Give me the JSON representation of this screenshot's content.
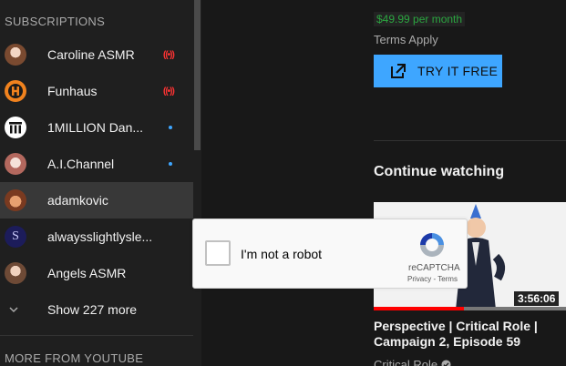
{
  "sidebar": {
    "section_title": "SUBSCRIPTIONS",
    "items": [
      {
        "label": "Caroline ASMR",
        "indicator": "live",
        "avatar_color": "#c9a38a"
      },
      {
        "label": "Funhaus",
        "indicator": "live",
        "avatar_color": "#f0821e"
      },
      {
        "label": "1MILLION Dan...",
        "indicator": "dot",
        "avatar_color": "#ffffff"
      },
      {
        "label": "A.I.Channel",
        "indicator": "dot",
        "avatar_color": "#e8cfc8"
      },
      {
        "label": "adamkovic",
        "indicator": "none",
        "avatar_color": "#d86a3a"
      },
      {
        "label": "alwaysslightlysle...",
        "indicator": "none",
        "avatar_color": "#1c1c5a"
      },
      {
        "label": "Angels ASMR",
        "indicator": "none",
        "avatar_color": "#a88a78"
      }
    ],
    "show_more_label": "Show 227 more",
    "section2_title": "MORE FROM YOUTUBE"
  },
  "promo": {
    "price": "$49.99 per month",
    "terms": "Terms Apply",
    "button_label": "TRY IT FREE"
  },
  "continue_watching": {
    "title": "Continue watching",
    "video": {
      "title": "Perspective | Critical Role | Campaign 2, Episode 59",
      "duration": "3:56:06",
      "channel": "Critical Role",
      "progress": 0.47
    }
  },
  "captcha": {
    "label": "I'm not a robot",
    "brand": "reCAPTCHA",
    "links": "Privacy - Terms"
  },
  "colors": {
    "accent": "#3ea6ff",
    "live": "#ff3333",
    "price_green": "#2ba640",
    "progress_red": "#ff0000"
  }
}
